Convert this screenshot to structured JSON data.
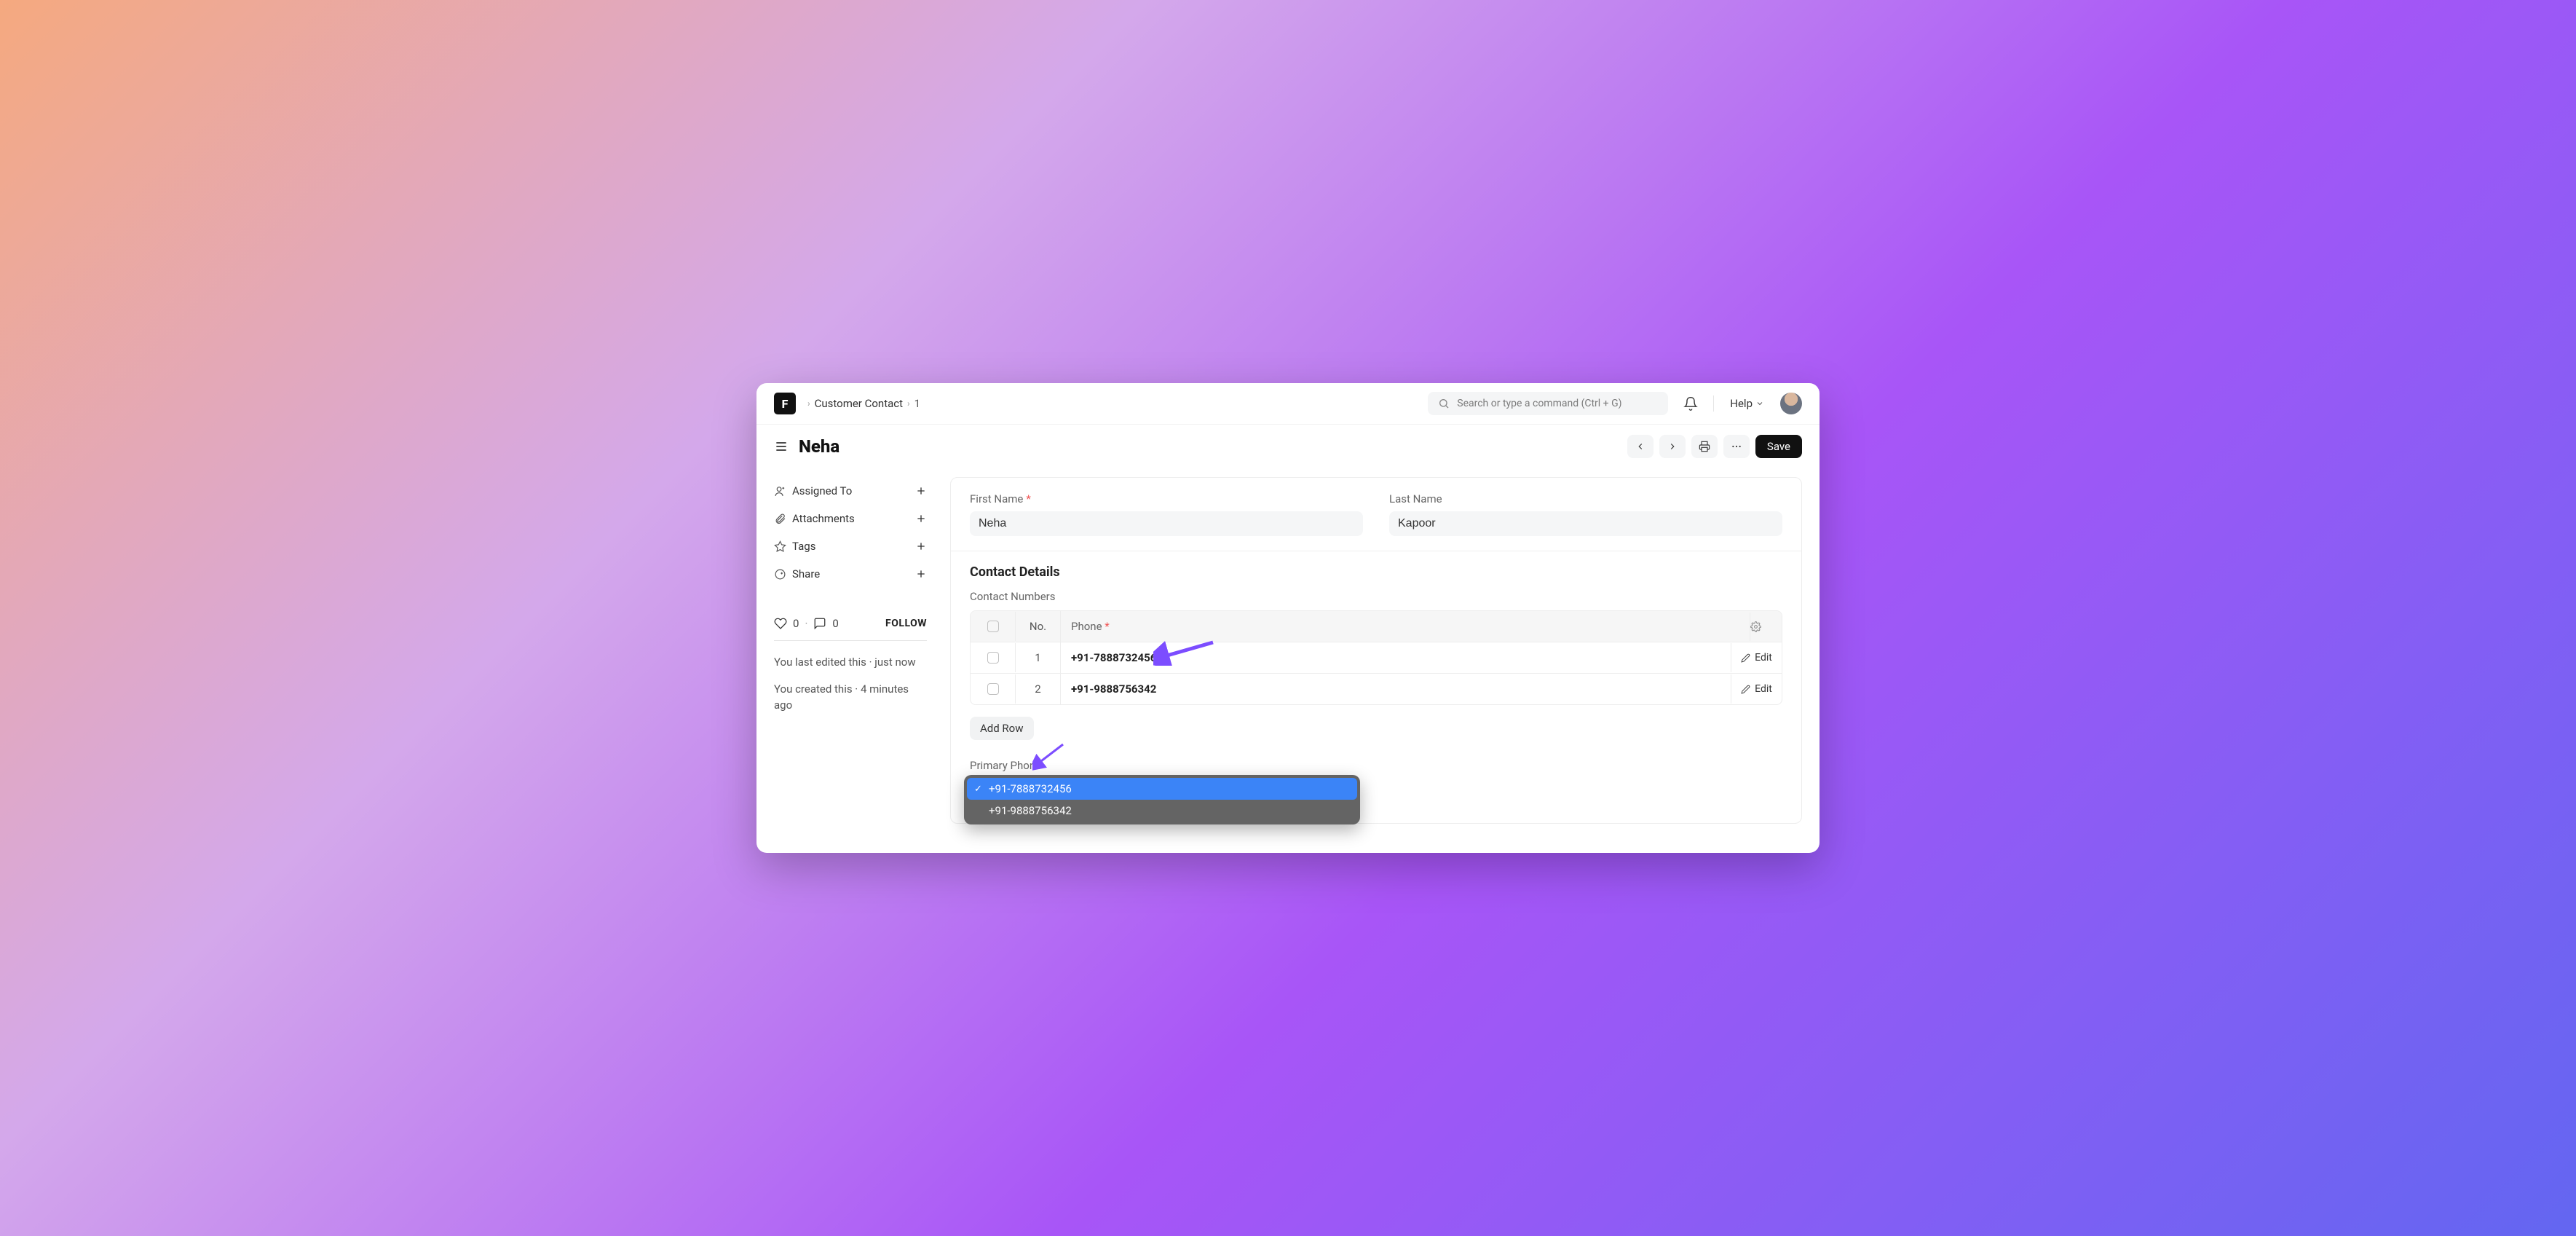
{
  "breadcrumb": {
    "parent": "Customer Contact",
    "id": "1"
  },
  "search": {
    "placeholder": "Search or type a command (Ctrl + G)"
  },
  "help": {
    "label": "Help"
  },
  "page_title": "Neha",
  "save_label": "Save",
  "sidebar": {
    "items": [
      {
        "label": "Assigned To"
      },
      {
        "label": "Attachments"
      },
      {
        "label": "Tags"
      },
      {
        "label": "Share"
      }
    ],
    "likes": "0",
    "comments": "0",
    "follow_label": "FOLLOW",
    "history_edit": "You last edited this · just now",
    "history_create": "You created this · 4 minutes ago"
  },
  "form": {
    "first_name_label": "First Name",
    "first_name": "Neha",
    "last_name_label": "Last Name",
    "last_name": "Kapoor"
  },
  "contact": {
    "section_title": "Contact Details",
    "numbers_label": "Contact Numbers",
    "col_no": "No.",
    "col_phone": "Phone",
    "rows": [
      {
        "no": "1",
        "phone": "+91-7888732456"
      },
      {
        "no": "2",
        "phone": "+91-9888756342"
      }
    ],
    "edit_label": "Edit",
    "add_row": "Add Row",
    "primary_label": "Primary Phone",
    "options": [
      "+91-7888732456",
      "+91-9888756342"
    ]
  }
}
